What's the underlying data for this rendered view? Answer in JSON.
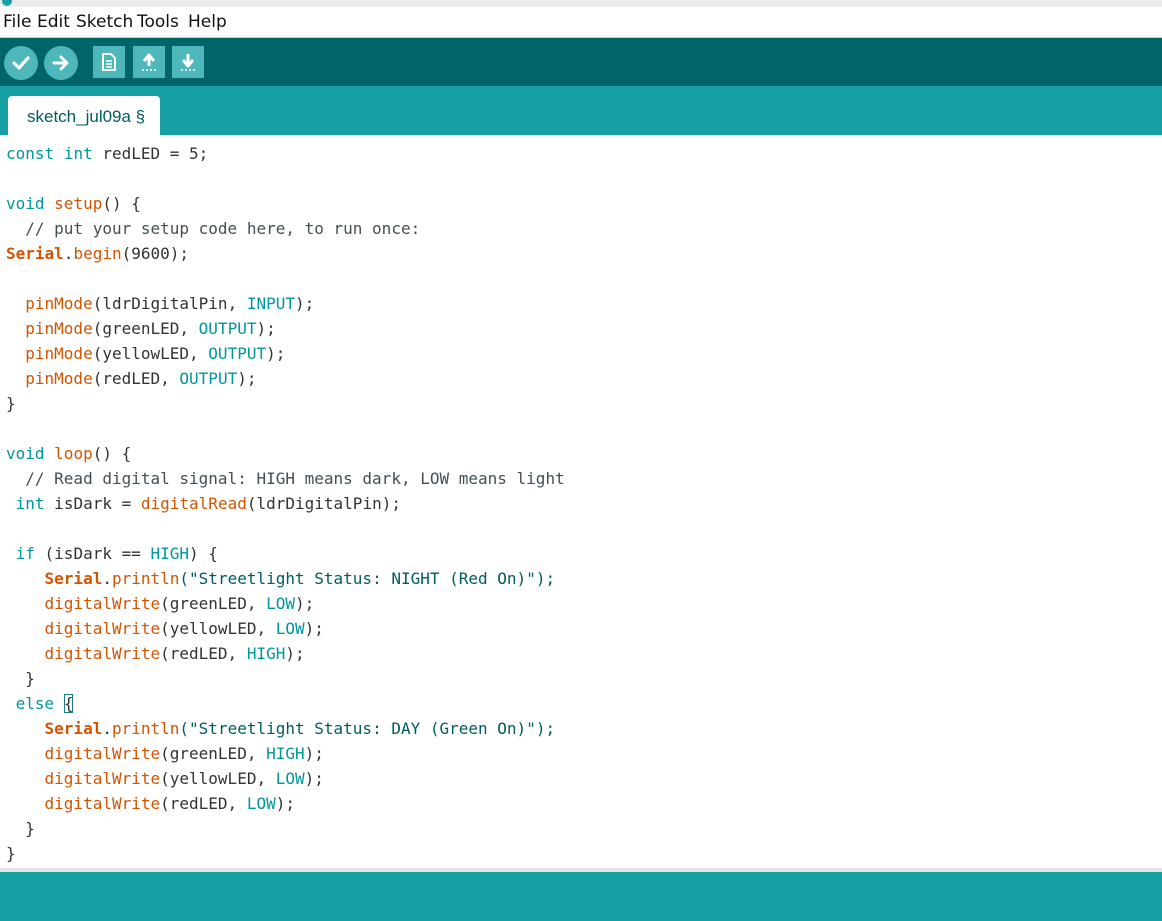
{
  "menu": [
    "File",
    "Edit",
    "Sketch",
    "Tools",
    "Help"
  ],
  "toolbar": {
    "buttons": [
      {
        "name": "verify",
        "icon": "check-icon"
      },
      {
        "name": "upload",
        "icon": "arrow-right-icon"
      },
      {
        "name": "new",
        "icon": "document-icon"
      },
      {
        "name": "open",
        "icon": "arrow-up-icon"
      },
      {
        "name": "save",
        "icon": "arrow-down-icon"
      }
    ]
  },
  "tab": {
    "label": "sketch_jul09a §"
  },
  "colors": {
    "toolbar": "#006468",
    "tabbar": "#17a1a5",
    "button": "#4db7bb",
    "keyword": "#00979c",
    "function": "#d35400"
  },
  "code": [
    {
      "t": "const",
      "c": "kw"
    },
    {
      "t": " "
    },
    {
      "t": "int",
      "c": "kw"
    },
    {
      "t": " redLED = 5;"
    }
  ],
  "lines": [
    [
      {
        "t": "const",
        "c": "kw"
      },
      {
        "t": " "
      },
      {
        "t": "int",
        "c": "kw"
      },
      {
        "t": " redLED = 5;"
      }
    ],
    [],
    [
      {
        "t": "void",
        "c": "kw"
      },
      {
        "t": " "
      },
      {
        "t": "setup",
        "c": "fn"
      },
      {
        "t": "() {"
      }
    ],
    [
      {
        "t": "  // put your setup code here, to run once:",
        "c": "cm"
      }
    ],
    [
      {
        "t": "Serial",
        "c": "cls"
      },
      {
        "t": "."
      },
      {
        "t": "begin",
        "c": "fn"
      },
      {
        "t": "(9600);"
      }
    ],
    [],
    [
      {
        "t": "  "
      },
      {
        "t": "pinMode",
        "c": "fn"
      },
      {
        "t": "(ldrDigitalPin, "
      },
      {
        "t": "INPUT",
        "c": "kw"
      },
      {
        "t": ");"
      }
    ],
    [
      {
        "t": "  "
      },
      {
        "t": "pinMode",
        "c": "fn"
      },
      {
        "t": "(greenLED, "
      },
      {
        "t": "OUTPUT",
        "c": "kw"
      },
      {
        "t": ");"
      }
    ],
    [
      {
        "t": "  "
      },
      {
        "t": "pinMode",
        "c": "fn"
      },
      {
        "t": "(yellowLED, "
      },
      {
        "t": "OUTPUT",
        "c": "kw"
      },
      {
        "t": ");"
      }
    ],
    [
      {
        "t": "  "
      },
      {
        "t": "pinMode",
        "c": "fn"
      },
      {
        "t": "(redLED, "
      },
      {
        "t": "OUTPUT",
        "c": "kw"
      },
      {
        "t": ");"
      }
    ],
    [
      {
        "t": "}"
      }
    ],
    [],
    [
      {
        "t": "void",
        "c": "kw"
      },
      {
        "t": " "
      },
      {
        "t": "loop",
        "c": "fn"
      },
      {
        "t": "() {"
      }
    ],
    [
      {
        "t": "  // Read digital signal: HIGH means dark, LOW means light",
        "c": "cm"
      }
    ],
    [
      {
        "t": " "
      },
      {
        "t": "int",
        "c": "kw"
      },
      {
        "t": " isDark = "
      },
      {
        "t": "digitalRead",
        "c": "fn"
      },
      {
        "t": "(ldrDigitalPin);"
      }
    ],
    [],
    [
      {
        "t": " "
      },
      {
        "t": "if",
        "c": "kw"
      },
      {
        "t": " (isDark == "
      },
      {
        "t": "HIGH",
        "c": "kw"
      },
      {
        "t": ") {"
      }
    ],
    [
      {
        "t": "    "
      },
      {
        "t": "Serial",
        "c": "cls"
      },
      {
        "t": "."
      },
      {
        "t": "println",
        "c": "fn"
      },
      {
        "t": "(\"Streetlight Status: NIGHT (Red On)\");",
        "c": "st"
      }
    ],
    [
      {
        "t": "    "
      },
      {
        "t": "digitalWrite",
        "c": "fn"
      },
      {
        "t": "(greenLED, "
      },
      {
        "t": "LOW",
        "c": "kw"
      },
      {
        "t": ");"
      }
    ],
    [
      {
        "t": "    "
      },
      {
        "t": "digitalWrite",
        "c": "fn"
      },
      {
        "t": "(yellowLED, "
      },
      {
        "t": "LOW",
        "c": "kw"
      },
      {
        "t": ");"
      }
    ],
    [
      {
        "t": "    "
      },
      {
        "t": "digitalWrite",
        "c": "fn"
      },
      {
        "t": "(redLED, "
      },
      {
        "t": "HIGH",
        "c": "kw"
      },
      {
        "t": ");"
      }
    ],
    [
      {
        "t": "  }"
      }
    ],
    [
      {
        "t": " "
      },
      {
        "t": "else",
        "c": "kw"
      },
      {
        "t": " "
      },
      {
        "t": "{",
        "c": "cursor"
      }
    ],
    [
      {
        "t": "    "
      },
      {
        "t": "Serial",
        "c": "cls"
      },
      {
        "t": "."
      },
      {
        "t": "println",
        "c": "fn"
      },
      {
        "t": "(\"Streetlight Status: DAY (Green On)\");",
        "c": "st"
      }
    ],
    [
      {
        "t": "    "
      },
      {
        "t": "digitalWrite",
        "c": "fn"
      },
      {
        "t": "(greenLED, "
      },
      {
        "t": "HIGH",
        "c": "kw"
      },
      {
        "t": ");"
      }
    ],
    [
      {
        "t": "    "
      },
      {
        "t": "digitalWrite",
        "c": "fn"
      },
      {
        "t": "(yellowLED, "
      },
      {
        "t": "LOW",
        "c": "kw"
      },
      {
        "t": ");"
      }
    ],
    [
      {
        "t": "    "
      },
      {
        "t": "digitalWrite",
        "c": "fn"
      },
      {
        "t": "(redLED, "
      },
      {
        "t": "LOW",
        "c": "kw"
      },
      {
        "t": ");"
      }
    ],
    [
      {
        "t": "  }"
      }
    ],
    [
      {
        "t": "}"
      }
    ]
  ]
}
